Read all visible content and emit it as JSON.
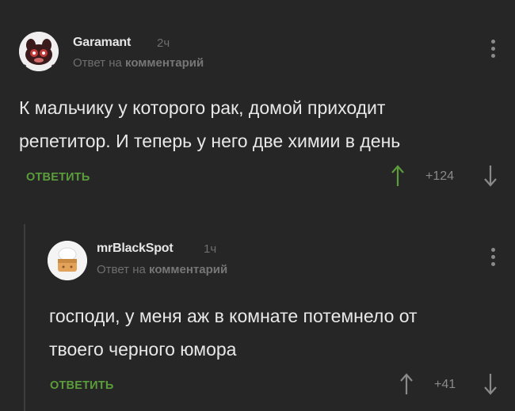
{
  "comments": [
    {
      "username": "Garamant",
      "time": "2ч",
      "reply_prefix": "Ответ на",
      "reply_target": "комментарий",
      "text_lines": [
        "К мальчику у которого рак, домой приходит",
        "репетитор. И теперь у него две химии в день"
      ],
      "reply_label": "ОТВЕТИТЬ",
      "score": "+124"
    },
    {
      "username": "mrBlackSpot",
      "time": "1ч",
      "reply_prefix": "Ответ на",
      "reply_target": "комментарий",
      "text_lines": [
        "господи, у меня аж в комнате потемнело от",
        "твоего черного юмора"
      ],
      "reply_label": "ОТВЕТИТЬ",
      "score": "+41"
    }
  ],
  "icons": {
    "upvote": "arrow-up-icon",
    "downvote": "arrow-down-icon",
    "menu": "more-vertical-icon"
  },
  "colors": {
    "background": "#262626",
    "text": "#e8e8e8",
    "muted": "#6f6f6f",
    "accent_green": "#5b9d3b",
    "thread_line": "#3d3d3d"
  }
}
